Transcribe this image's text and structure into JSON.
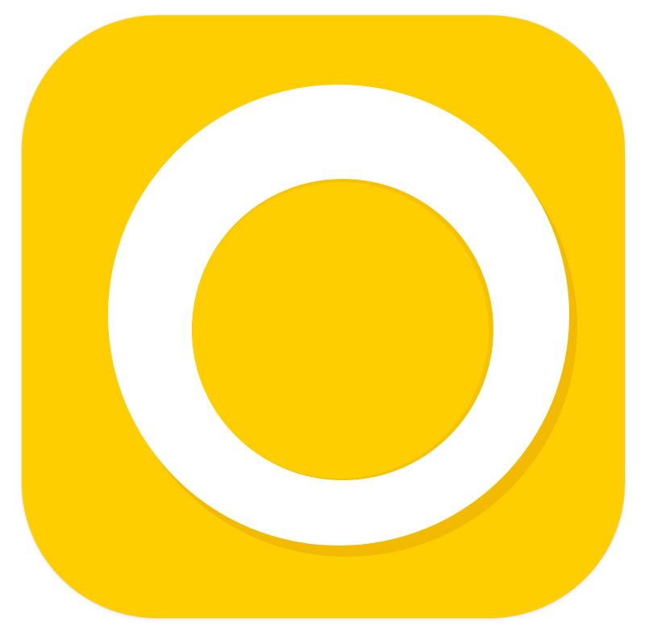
{
  "icon": {
    "name": "ring-logo-icon",
    "colors": {
      "background": "#FFCE00",
      "ring": "#FFFFFF",
      "inner": "#FFCE00",
      "ring_shadow": "#F2BA00",
      "inner_shadow": "#F5C100"
    }
  }
}
